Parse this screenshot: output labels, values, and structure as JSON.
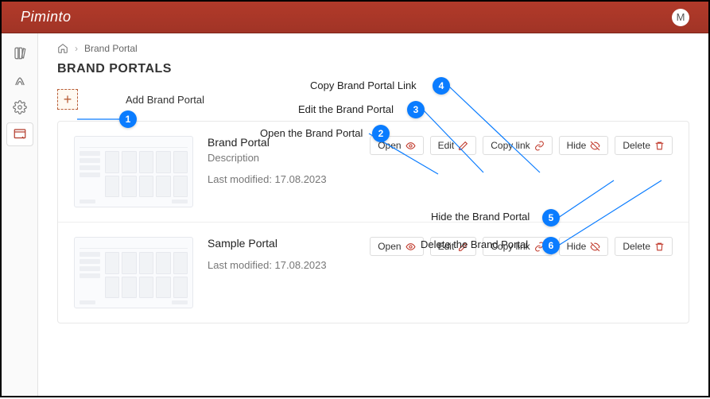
{
  "app": {
    "name": "Piminto",
    "user_initial": "M"
  },
  "breadcrumb": {
    "item": "Brand Portal"
  },
  "page": {
    "title": "BRAND PORTALS"
  },
  "add": {
    "label": "Add Brand Portal"
  },
  "actions": {
    "open": "Open",
    "edit": "Edit",
    "copy": "Copy link",
    "hide": "Hide",
    "delete": "Delete"
  },
  "meta": {
    "prefix": "Last modified: "
  },
  "portals": [
    {
      "name": "Brand Portal",
      "description": "Description",
      "modified": "17.08.2023"
    },
    {
      "name": "Sample Portal",
      "description": "",
      "modified": "17.08.2023"
    }
  ],
  "callouts": {
    "1": "Add Brand Portal",
    "2": "Open the Brand Portal",
    "3": "Edit the Brand Portal",
    "4": "Copy Brand Portal Link",
    "5": "Hide the Brand Portal",
    "6": "Delete the Brand Portal"
  }
}
